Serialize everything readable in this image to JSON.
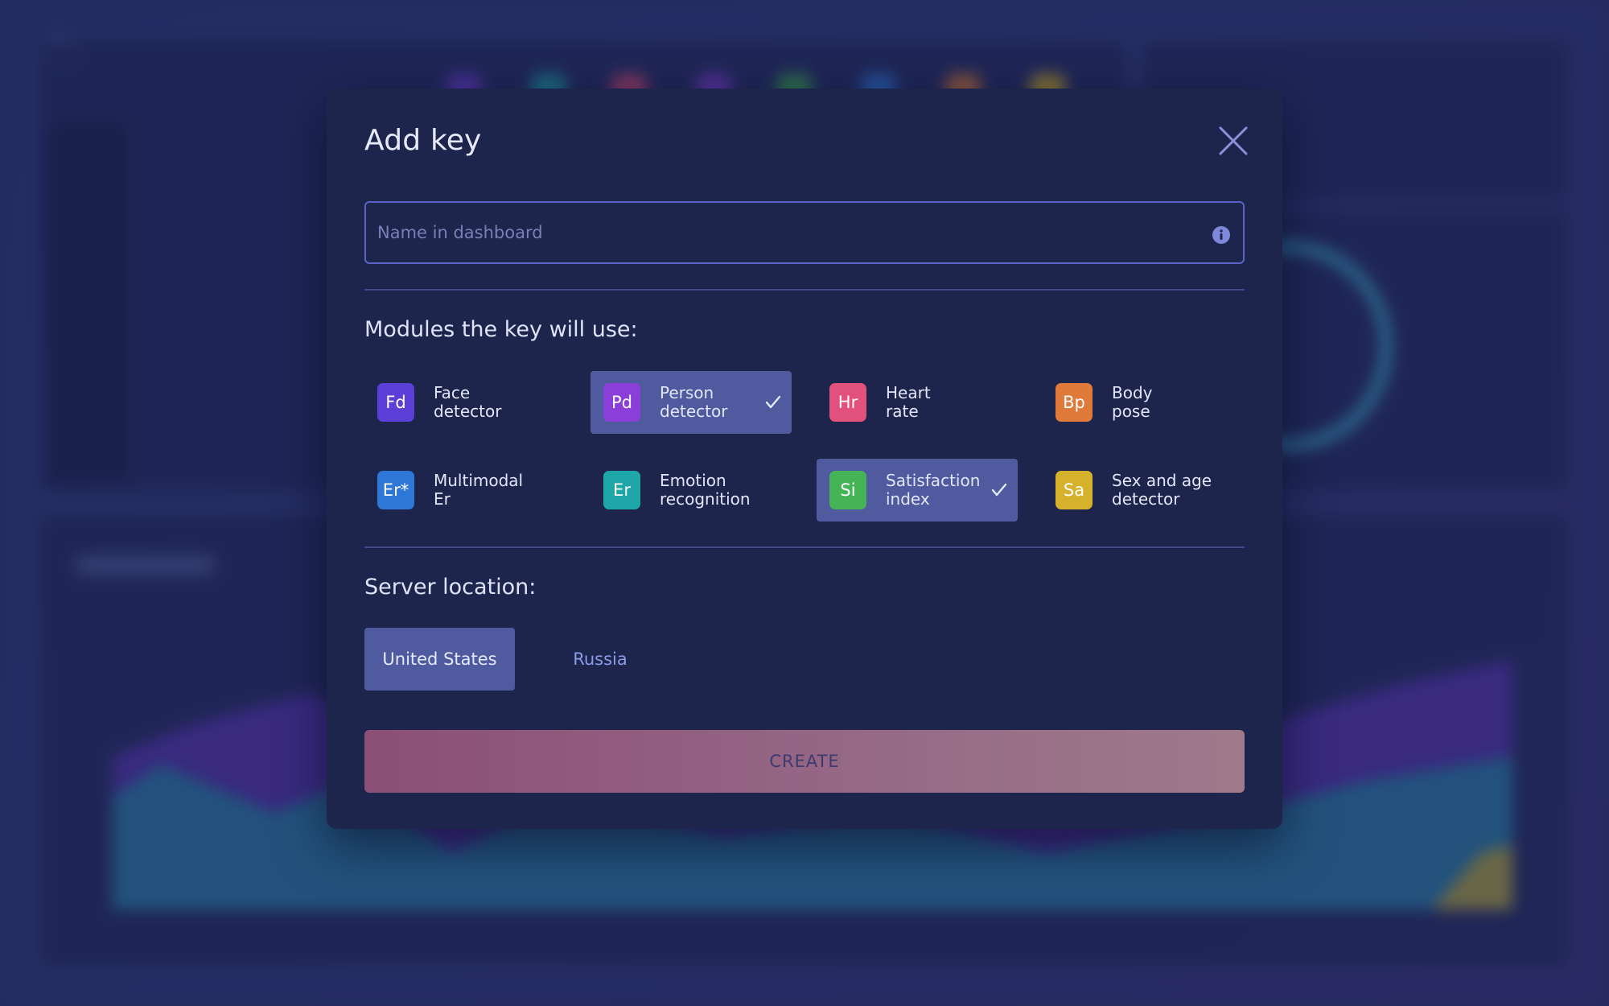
{
  "modal": {
    "title": "Add key",
    "close_icon": "close-icon",
    "name_field": {
      "value": "",
      "placeholder": "Name in dashboard",
      "info_icon": "info-icon"
    },
    "modules_label": "Modules the key will use:",
    "modules": [
      {
        "abbr": "Fd",
        "name": "Face\ndetector",
        "selected": false,
        "color": "#5b3fd6"
      },
      {
        "abbr": "Pd",
        "name": "Person\ndetector",
        "selected": true,
        "color": "#8b3fd8"
      },
      {
        "abbr": "Hr",
        "name": "Heart\nrate",
        "selected": false,
        "color": "#e2517e"
      },
      {
        "abbr": "Bp",
        "name": "Body\npose",
        "selected": false,
        "color": "#e07a3a"
      },
      {
        "abbr": "Er*",
        "name": "Multimodal\nEr",
        "selected": false,
        "color": "#2f77d6"
      },
      {
        "abbr": "Er",
        "name": "Emotion\nrecognition",
        "selected": false,
        "color": "#1fa6a8"
      },
      {
        "abbr": "Si",
        "name": "Satisfaction\nindex",
        "selected": true,
        "color": "#45b457"
      },
      {
        "abbr": "Sa",
        "name": "Sex and age\ndetector",
        "selected": false,
        "color": "#d6b22c"
      }
    ],
    "server_label": "Server location:",
    "locations": [
      {
        "label": "United States",
        "selected": true
      },
      {
        "label": "Russia",
        "selected": false
      }
    ],
    "create_label": "CREATE",
    "colors": {
      "modal_bg": "#1e254d",
      "selected_bg": "#4f5a9f",
      "field_border": "#5b64c4",
      "accent_link": "#8c9be6",
      "create_gradient_start": "#8c4f76",
      "create_gradient_end": "#9e7a8a"
    }
  }
}
